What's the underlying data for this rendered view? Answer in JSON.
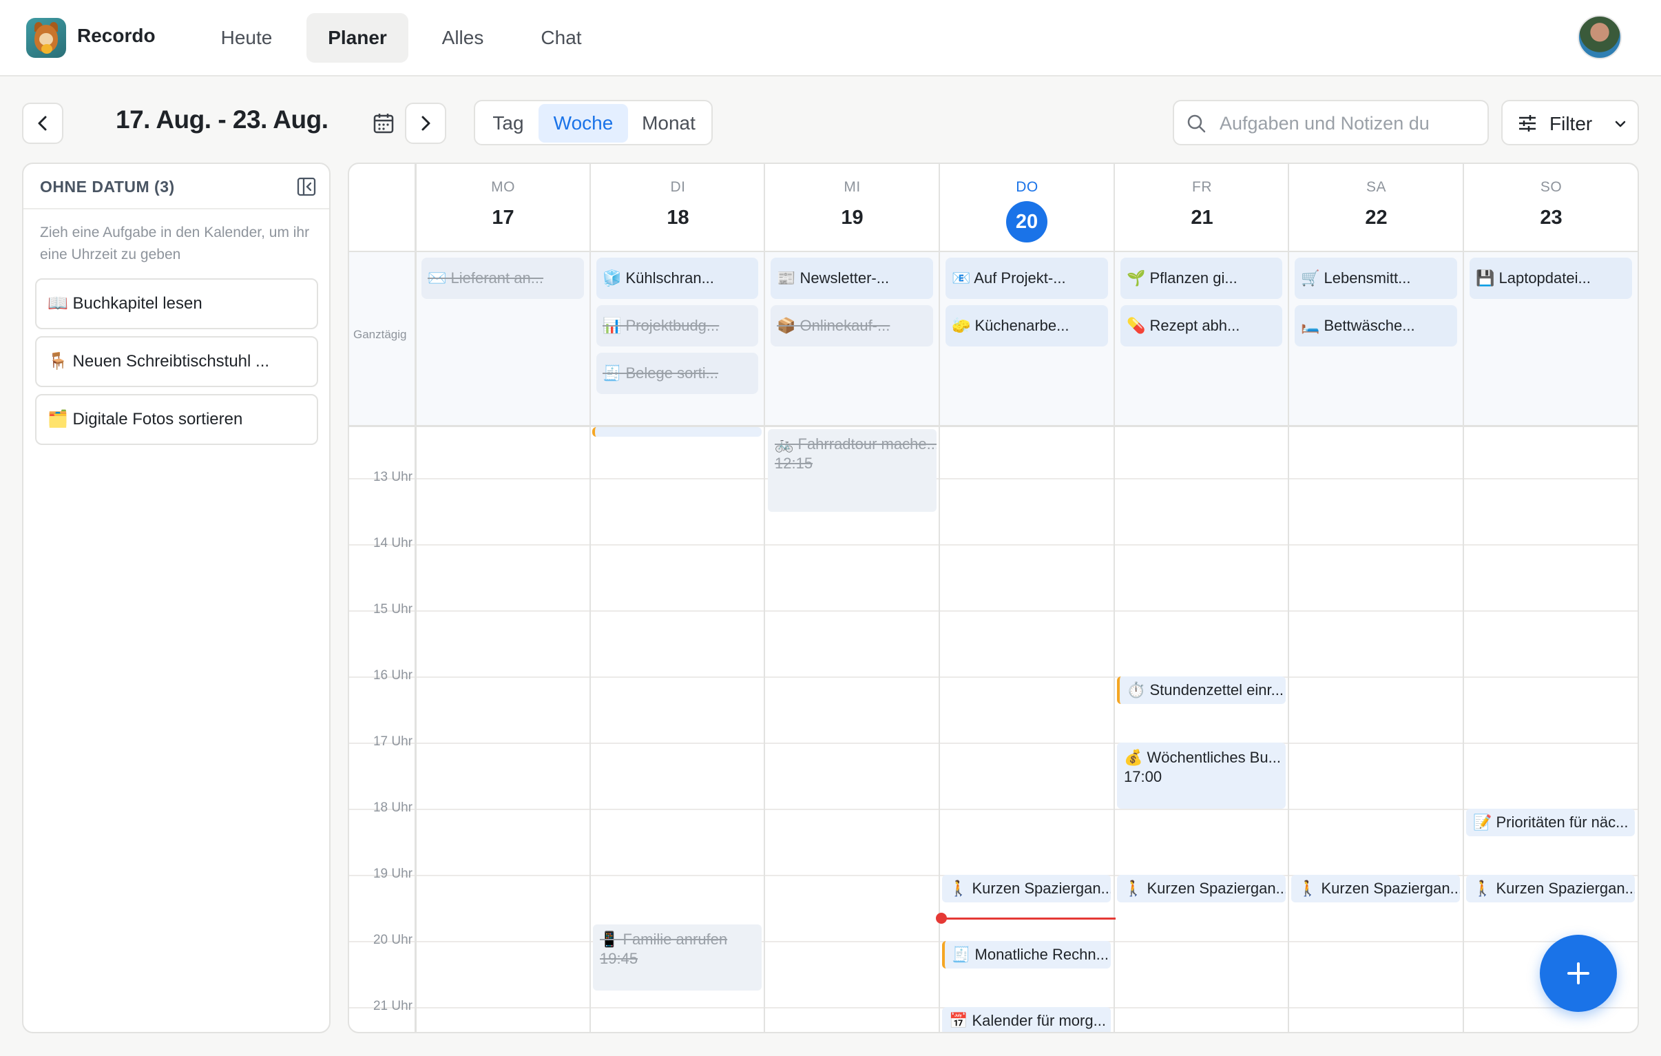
{
  "app": {
    "name": "Recordo"
  },
  "nav": {
    "items": [
      {
        "label": "Heute"
      },
      {
        "label": "Planer"
      },
      {
        "label": "Alles"
      },
      {
        "label": "Chat"
      }
    ],
    "active": "Planer"
  },
  "toolbar": {
    "date_range": "17. Aug. - 23. Aug.",
    "views": [
      "Tag",
      "Woche",
      "Monat"
    ],
    "active_view": "Woche",
    "search_placeholder": "Aufgaben und Notizen du",
    "filter_label": "Filter"
  },
  "sidebar": {
    "title": "OHNE DATUM (3)",
    "hint": "Zieh eine Aufgabe in den Kalender, um ihr eine Uhrzeit zu geben",
    "items": [
      "📖 Buchkapitel lesen",
      "🪑 Neuen Schreibtischstuhl ...",
      "🗂️ Digitale Fotos sortieren"
    ]
  },
  "calendar": {
    "days": [
      {
        "name": "MO",
        "date": "17"
      },
      {
        "name": "DI",
        "date": "18"
      },
      {
        "name": "MI",
        "date": "19"
      },
      {
        "name": "DO",
        "date": "20",
        "today": true
      },
      {
        "name": "FR",
        "date": "21"
      },
      {
        "name": "SA",
        "date": "22"
      },
      {
        "name": "SO",
        "date": "23"
      }
    ],
    "allday_label": "Ganztägig",
    "allday": {
      "mo": [
        {
          "text": "✉️ Lieferant an...",
          "done": true
        }
      ],
      "di": [
        {
          "text": "🧊 Kühlschran...",
          "done": false
        },
        {
          "text": "📊 Projektbudg...",
          "done": true
        },
        {
          "text": "🧾 Belege sorti...",
          "done": true
        }
      ],
      "mi": [
        {
          "text": "📰 Newsletter-...",
          "done": false
        },
        {
          "text": "📦 Onlinekauf-...",
          "done": true
        }
      ],
      "do": [
        {
          "text": "📧 Auf Projekt-...",
          "done": false
        },
        {
          "text": "🧽 Küchenarbe...",
          "done": false
        }
      ],
      "fr": [
        {
          "text": "🌱 Pflanzen gi...",
          "done": false
        },
        {
          "text": "💊 Rezept abh...",
          "done": false
        }
      ],
      "sa": [
        {
          "text": "🛒 Lebensmitt...",
          "done": false
        },
        {
          "text": "🛏️ Bettwäsche...",
          "done": false
        }
      ],
      "so": [
        {
          "text": "💾 Laptopdatei...",
          "done": false
        }
      ]
    },
    "hours": [
      "13 Uhr",
      "14 Uhr",
      "15 Uhr",
      "16 Uhr",
      "17 Uhr",
      "18 Uhr",
      "19 Uhr",
      "20 Uhr",
      "21 Uhr"
    ],
    "events": {
      "mi_bike": {
        "text": "🚲 Fahrradtour mache...",
        "time": "12:15",
        "done": true
      },
      "fr_timesheet": {
        "text": "⏱️ Stundenzettel einr..."
      },
      "fr_budget": {
        "text": "💰 Wöchentliches Bu...",
        "time": "17:00"
      },
      "so_priorities": {
        "text": "📝 Prioritäten für näc..."
      },
      "walk": "🚶 Kurzen Spaziergan...",
      "di_call": {
        "text": "📱 Familie anrufen",
        "time": "19:45",
        "done": true
      },
      "do_bills": {
        "text": "🧾 Monatliche Rechn..."
      },
      "do_calendar": {
        "text": "📅 Kalender für morg..."
      }
    }
  }
}
